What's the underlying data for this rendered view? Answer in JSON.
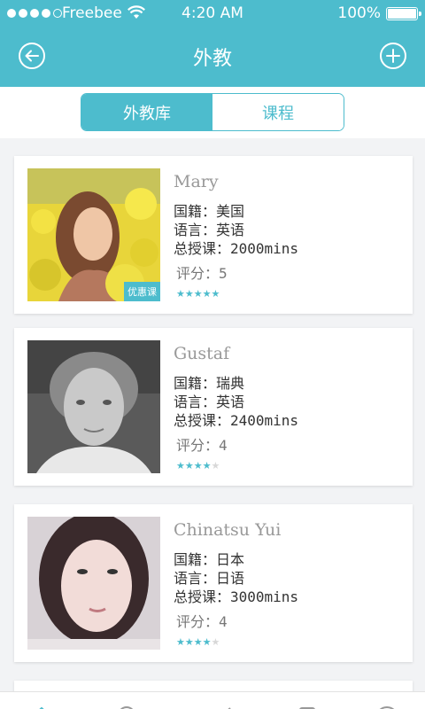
{
  "status_bar": {
    "carrier": "Freebee",
    "time": "4:20 AM",
    "battery": "100%",
    "signal_dots_filled": 4,
    "signal_dots_total": 5
  },
  "nav": {
    "title": "外教",
    "back_icon": "back-circle-icon",
    "add_icon": "add-circle-icon"
  },
  "segment": {
    "tabs": [
      {
        "label": "外教库",
        "active": true
      },
      {
        "label": "课程",
        "active": false
      }
    ]
  },
  "teachers": [
    {
      "name": "Mary",
      "nationality": "国籍：美国",
      "language": "语言：英语",
      "total_lessons": "总授课：2000mins",
      "rating_text": "评分：5",
      "rating": 5,
      "badge": "优惠课"
    },
    {
      "name": "Gustaf",
      "nationality": "国籍：瑞典",
      "language": "语言：英语",
      "total_lessons": "总授课：2400mins",
      "rating_text": "评分：4",
      "rating": 4
    },
    {
      "name": "Chinatsu Yui",
      "nationality": "国籍：日本",
      "language": "语言：日语",
      "total_lessons": "总授课：3000mins",
      "rating_text": "评分：4",
      "rating": 4
    }
  ],
  "colors": {
    "accent": "#4dbccd",
    "star_off": "#d8d8d8"
  }
}
